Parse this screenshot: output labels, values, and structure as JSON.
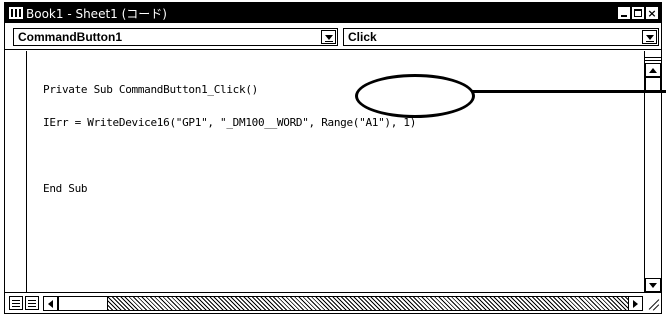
{
  "window": {
    "title": "Book1 - Sheet1 (コード)",
    "icon": "vba-module-icon",
    "controls": {
      "minimize": "minimize-icon",
      "maximize": "maximize-icon",
      "close": "×"
    }
  },
  "object_combo": {
    "value": "CommandButton1"
  },
  "procedure_combo": {
    "value": "Click"
  },
  "code": {
    "lines": [
      "Private Sub CommandButton1_Click()",
      "IErr = WriteDevice16(\"GP1\", \"_DM100__WORD\", Range(\"A1\"), 1)",
      "",
      "End Sub"
    ]
  },
  "annotation": {
    "highlighted_text": "Range(\"A1\")"
  },
  "bottom_bar": {
    "procedure_view_icon": "procedure-view-icon",
    "full_module_view_icon": "full-module-view-icon"
  }
}
